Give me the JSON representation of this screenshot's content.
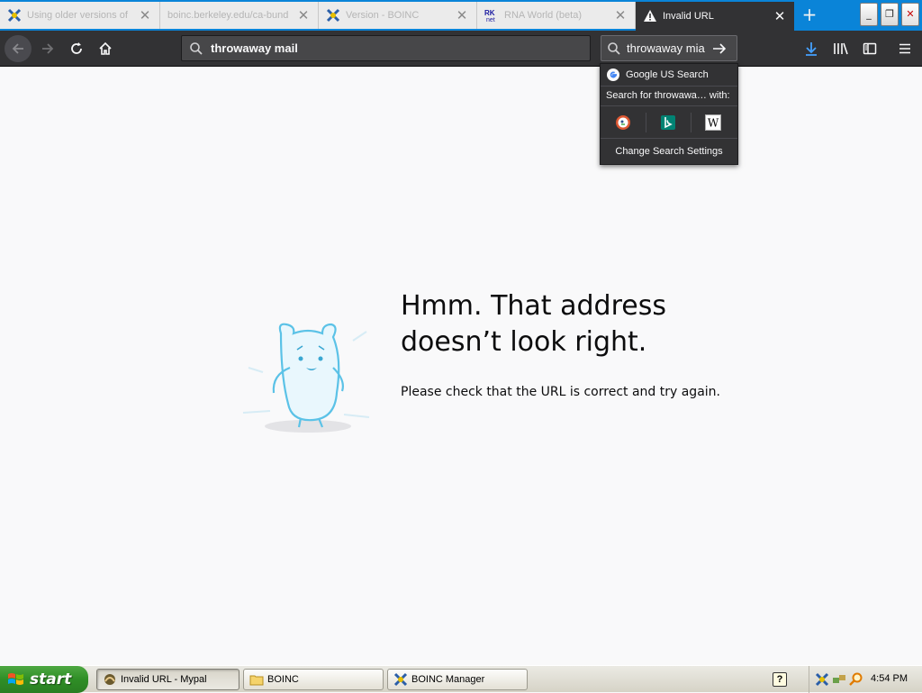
{
  "browser": {
    "tabs": [
      {
        "title": "Using older versions of",
        "icon": "boinc-icon",
        "active": false
      },
      {
        "title": "boinc.berkeley.edu/ca-bund",
        "icon": "none",
        "active": false
      },
      {
        "title": "Version - BOINC",
        "icon": "boinc-icon",
        "active": false
      },
      {
        "title": "RNA World (beta)",
        "icon": "rknet-icon",
        "active": false
      },
      {
        "title": "Invalid URL",
        "icon": "warning-icon",
        "active": true
      }
    ],
    "new_tab_label": "+",
    "window_buttons": {
      "minimize": "_",
      "restore": "❐",
      "close": "✕"
    },
    "url": "throwaway mail",
    "search_value": "throwaway mia",
    "search_popup": {
      "default_engine": "Google US Search",
      "search_for_label": "Search for throwawa… with:",
      "engines": [
        "duckduckgo-icon",
        "bing-icon",
        "wikipedia-icon"
      ],
      "wikipedia_glyph": "W",
      "settings_label": "Change Search Settings"
    }
  },
  "error_page": {
    "title_line1": "Hmm. That address",
    "title_line2": "doesn’t look right.",
    "description": "Please check that the URL is correct and try again."
  },
  "taskbar": {
    "start_label": "start",
    "tasks": [
      {
        "label": "Invalid URL - Mypal",
        "icon": "mypal-icon",
        "active": true
      },
      {
        "label": "BOINC",
        "icon": "folder-icon",
        "active": false
      },
      {
        "label": "BOINC Manager",
        "icon": "boinc-icon",
        "active": false
      }
    ],
    "help_glyph": "?",
    "clock": "4:54 PM"
  },
  "colors": {
    "tabstrip": "#0a84d8",
    "toolbar": "#323234",
    "page_bg": "#f9f9fa",
    "start_green": "#3c9a31"
  }
}
